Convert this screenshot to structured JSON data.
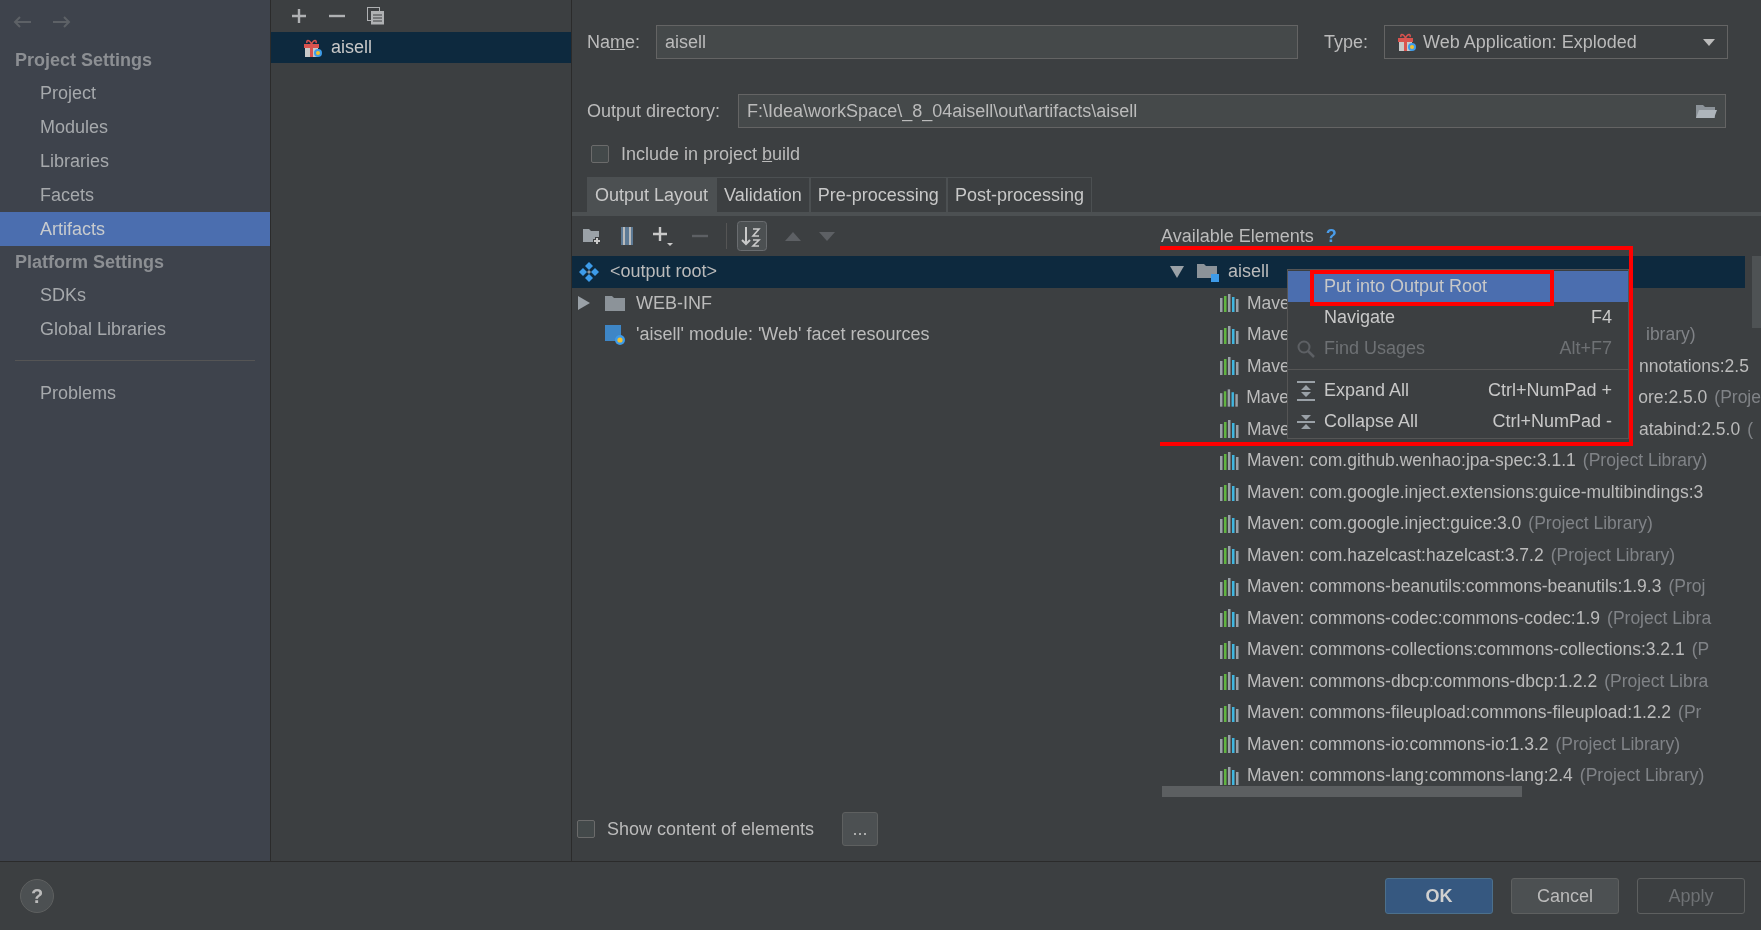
{
  "sidebar": {
    "groups": [
      {
        "title": "Project Settings",
        "items": [
          {
            "label": "Project",
            "selected": false
          },
          {
            "label": "Modules",
            "selected": false
          },
          {
            "label": "Libraries",
            "selected": false
          },
          {
            "label": "Facets",
            "selected": false
          },
          {
            "label": "Artifacts",
            "selected": true
          }
        ]
      },
      {
        "title": "Platform Settings",
        "items": [
          {
            "label": "SDKs",
            "selected": false
          },
          {
            "label": "Global Libraries",
            "selected": false
          }
        ]
      }
    ],
    "footer_items": [
      {
        "label": "Problems",
        "selected": false
      }
    ]
  },
  "artifacts": [
    {
      "name": "aisell",
      "selected": true
    }
  ],
  "form": {
    "name_label_parts": [
      "Na",
      "m",
      "e:"
    ],
    "name_value": "aisell",
    "type_label": "Type:",
    "type_value": "Web Application: Exploded",
    "output_label": "Output directory:",
    "output_value": "F:\\Idea\\workSpace\\_8_04aisell\\out\\artifacts\\aisell",
    "include_label_parts": [
      "Include in project ",
      "b",
      "uild"
    ],
    "include_checked": false
  },
  "tabs": [
    {
      "label": "Output Layout",
      "selected": true
    },
    {
      "label": "Validation",
      "selected": false
    },
    {
      "label": "Pre-processing",
      "selected": false
    },
    {
      "label": "Post-processing",
      "selected": false
    }
  ],
  "layout_tree": [
    {
      "kind": "root",
      "label": "<output root>",
      "selected": true
    },
    {
      "kind": "folder",
      "label": "WEB-INF",
      "selected": false,
      "expanded": false
    },
    {
      "kind": "module",
      "label": "'aisell' module: 'Web' facet resources",
      "selected": false
    }
  ],
  "available": {
    "title": "Available Elements",
    "help": "?",
    "root": {
      "label": "aisell",
      "selected": true,
      "expanded": true,
      "children": [
        {
          "label": "Mave"
        },
        {
          "label": "Mave",
          "after_menu": {
            "suffix": "ibrary)"
          }
        },
        {
          "label": "Mave",
          "after_menu": {
            "tail": "nnotations:2.5"
          }
        },
        {
          "label": "Mave",
          "after_menu": {
            "tail": "ore:2.5.0",
            "suffix": "(Proje"
          }
        },
        {
          "label": "Mave",
          "after_menu": {
            "tail": "atabind:2.5.0",
            "suffix": "("
          }
        },
        {
          "label": "Maven: com.github.wenhao:jpa-spec:3.1.1",
          "suffix": "(Project Library)"
        },
        {
          "label": "Maven: com.google.inject.extensions:guice-multibindings:3"
        },
        {
          "label": "Maven: com.google.inject:guice:3.0",
          "suffix": "(Project Library)"
        },
        {
          "label": "Maven: com.hazelcast:hazelcast:3.7.2",
          "suffix": "(Project Library)"
        },
        {
          "label": "Maven: commons-beanutils:commons-beanutils:1.9.3",
          "suffix": "(Proj"
        },
        {
          "label": "Maven: commons-codec:commons-codec:1.9",
          "suffix": "(Project Libra"
        },
        {
          "label": "Maven: commons-collections:commons-collections:3.2.1",
          "suffix": "(P"
        },
        {
          "label": "Maven: commons-dbcp:commons-dbcp:1.2.2",
          "suffix": "(Project Libra"
        },
        {
          "label": "Maven: commons-fileupload:commons-fileupload:1.2.2",
          "suffix": "(Pr"
        },
        {
          "label": "Maven: commons-io:commons-io:1.3.2",
          "suffix": "(Project Library)"
        },
        {
          "label": "Maven: commons-lang:commons-lang:2.4",
          "suffix": "(Project Library)"
        }
      ]
    }
  },
  "context_menu": {
    "items": [
      {
        "kind": "item",
        "label": "Put into Output Root",
        "selected": true,
        "disabled": false
      },
      {
        "kind": "item",
        "label": "Navigate",
        "shortcut": "F4",
        "selected": false,
        "disabled": false
      },
      {
        "kind": "search",
        "label": "Find Usages",
        "shortcut": "Alt+F7",
        "selected": false,
        "disabled": true
      },
      {
        "kind": "separator"
      },
      {
        "kind": "expand",
        "label": "Expand All",
        "shortcut": "Ctrl+NumPad +",
        "selected": false,
        "disabled": false
      },
      {
        "kind": "collapse",
        "label": "Collapse All",
        "shortcut": "Ctrl+NumPad -",
        "selected": false,
        "disabled": false
      }
    ]
  },
  "show_content": {
    "label": "Show content of elements",
    "checked": false,
    "button": "..."
  },
  "help": "?",
  "buttons": [
    {
      "label": "OK",
      "kind": "default",
      "disabled": false
    },
    {
      "label": "Cancel",
      "kind": "normal",
      "disabled": false
    },
    {
      "label": "Apply",
      "kind": "normal",
      "disabled": true
    }
  ]
}
